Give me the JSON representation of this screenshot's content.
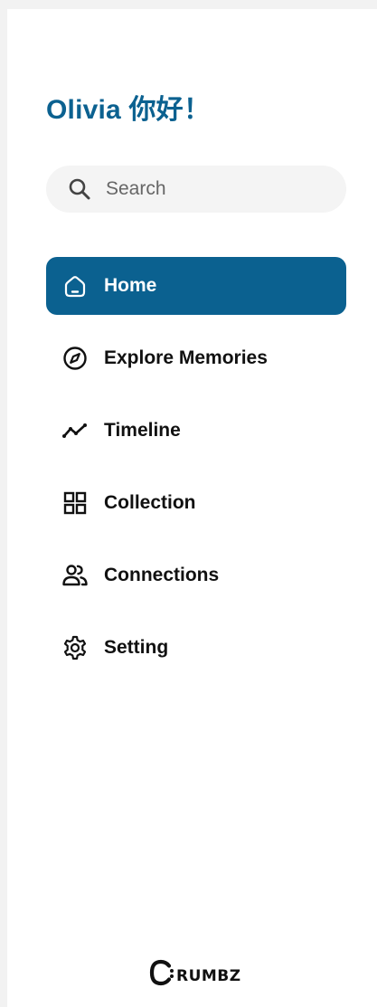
{
  "greeting": "Olivia 你好！",
  "search": {
    "placeholder": "Search",
    "icon": "search-icon"
  },
  "nav": {
    "items": [
      {
        "label": "Home",
        "icon": "home-icon",
        "active": true
      },
      {
        "label": "Explore Memories",
        "icon": "compass-icon",
        "active": false
      },
      {
        "label": "Timeline",
        "icon": "trend-line-icon",
        "active": false
      },
      {
        "label": "Collection",
        "icon": "grid-icon",
        "active": false
      },
      {
        "label": "Connections",
        "icon": "users-icon",
        "active": false
      },
      {
        "label": "Setting",
        "icon": "gear-icon",
        "active": false
      }
    ]
  },
  "logo": {
    "text": "Crumbz",
    "display_suffix": "RUMBZ"
  },
  "colors": {
    "accent": "#0b6190",
    "background": "#ffffff",
    "search_bg": "#f4f4f4",
    "text": "#111111"
  }
}
